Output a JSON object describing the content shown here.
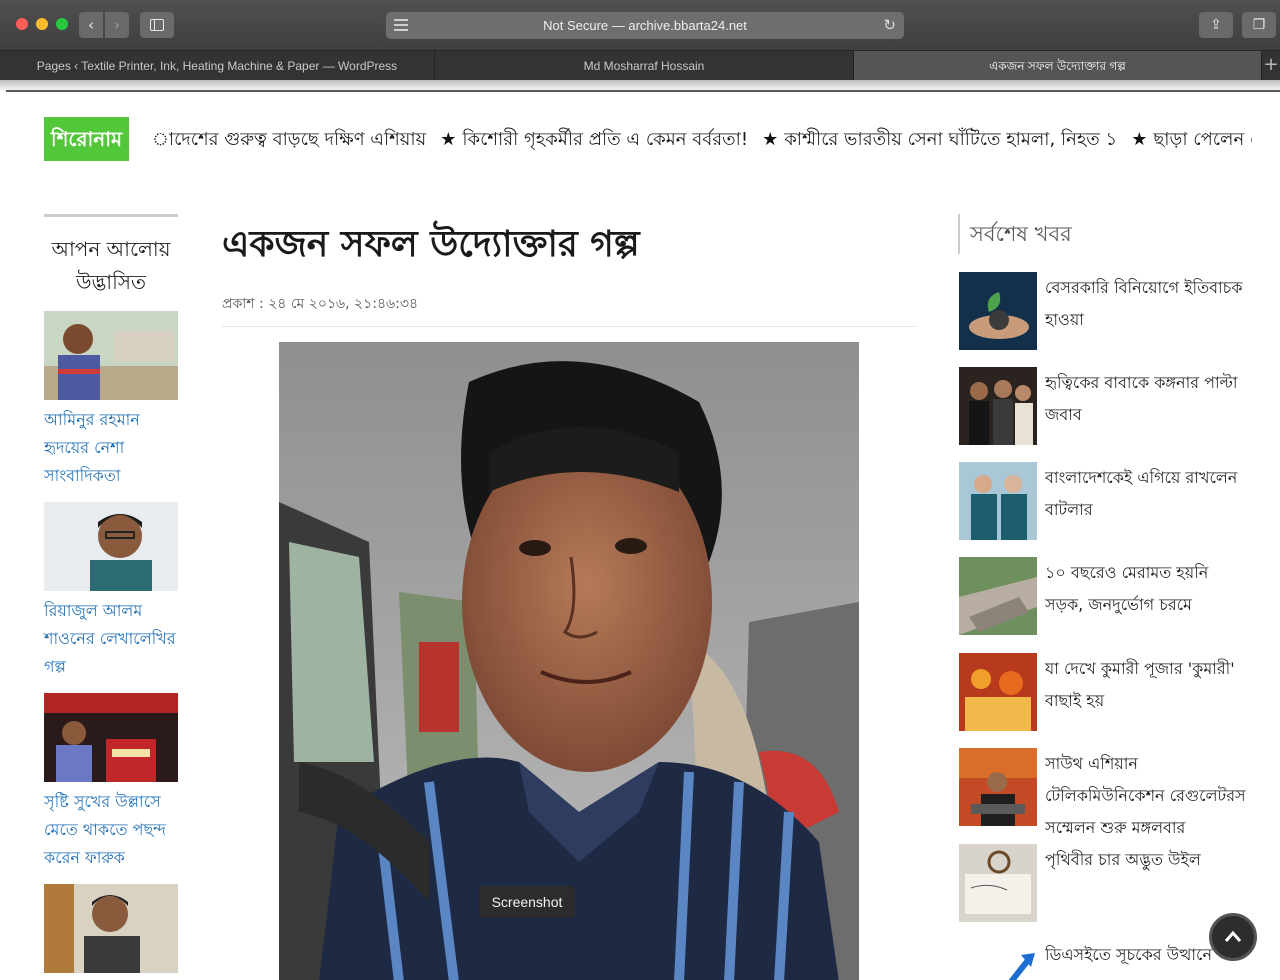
{
  "browser": {
    "address": "Not Secure — archive.bbarta24.net",
    "tabs": [
      {
        "label": "Pages ‹ Textile Printer, Ink, Heating Machine & Paper — WordPress"
      },
      {
        "label": "Md Mosharraf Hossain"
      },
      {
        "label": "একজন সফল উদ্যোক্তার গল্প"
      }
    ]
  },
  "ticker": {
    "label": "শিরোনাম",
    "items": [
      "াদেশের গুরুত্ব বাড়ছে দক্ষিণ এশিয়ায়",
      "কিশোরী গৃহকর্মীর প্রতি এ কেমন বর্বরতা!",
      "কাশ্মীরে ভারতীয় সেনা ঘাঁটিতে হামলা, নিহত ১",
      "ছাড়া পেলেন সেই মাশরাফি ভক্ত"
    ]
  },
  "left": {
    "heading": "আপন আলোয় উদ্ভাসিত",
    "items": [
      {
        "title": "আমিনুর রহমান হৃদয়ের নেশা সাংবাদিকতা"
      },
      {
        "title": "রিয়াজুল আলম শাওনের লেখালেখির গল্প"
      },
      {
        "title": "সৃষ্টি সুখের উল্লাসে মেতে থাকতে পছন্দ করেন ফারুক"
      },
      {
        "title": ""
      }
    ]
  },
  "article": {
    "title": "একজন সফল উদ্যোক্তার গল্প",
    "meta": "প্রকাশ : ২৪ মে ২০১৬, ২১:৪৬:৩৪",
    "tooltip": "Screenshot"
  },
  "right": {
    "heading": "সর্বশেষ খবর",
    "items": [
      {
        "title": "বেসরকারি বিনিয়োগে ইতিবাচক হাওয়া"
      },
      {
        "title": "হৃত্বিকের বাবাকে কঙ্গনার পাল্টা জবাব"
      },
      {
        "title": "বাংলাদেশকেই এগিয়ে রাখলেন বাটলার"
      },
      {
        "title": "১০ বছরেও মেরামত হয়নি সড়ক, জনদুর্ভোগ চরমে"
      },
      {
        "title": "যা দেখে কুমারী পূজার 'কুমারী' বাছাই হয়"
      },
      {
        "title": "সাউথ এশিয়ান টেলিকমিউনিকেশন রেগুলেটরস সম্মেলন শুরু মঙ্গলবার"
      },
      {
        "title": "পৃথিবীর চার অদ্ভুত উইল"
      },
      {
        "title": "ডিএসইতে সূচকের উত্থানে লেনদেন"
      }
    ]
  }
}
